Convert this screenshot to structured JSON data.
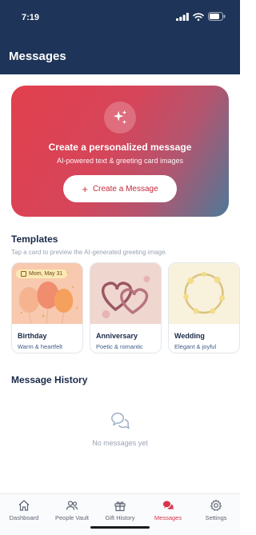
{
  "status_bar": {
    "time": "7:19"
  },
  "header": {
    "title": "Messages"
  },
  "hero": {
    "title": "Create a personalized message",
    "subtitle": "AI-powered text & greeting card images",
    "button_label": "Create a Message",
    "button_icon": "plus-icon",
    "badge_icon": "sparkles-icon"
  },
  "templates": {
    "title": "Templates",
    "hint": "Tap a card to preview the AI-generated greeting image.",
    "cards": [
      {
        "name": "Birthday",
        "subtitle": "Warm & heartfelt",
        "date_chip": "Mom, May 31"
      },
      {
        "name": "Anniversary",
        "subtitle": "Poetic & romantic"
      },
      {
        "name": "Wedding",
        "subtitle": "Elegant & joyful"
      }
    ]
  },
  "history": {
    "title": "Message History",
    "empty_text": "No messages yet",
    "empty_icon": "chat-bubbles-icon"
  },
  "tabs": [
    {
      "label": "Dashboard",
      "icon": "home-icon",
      "active": false
    },
    {
      "label": "People Vault",
      "icon": "people-icon",
      "active": false
    },
    {
      "label": "Gift History",
      "icon": "gift-icon",
      "active": false
    },
    {
      "label": "Messages",
      "icon": "chat-bubbles-icon",
      "active": true
    },
    {
      "label": "Settings",
      "icon": "gear-icon",
      "active": false
    }
  ],
  "colors": {
    "header": "#1e3458",
    "accent": "#d9344a",
    "hero_start": "#e2404d",
    "hero_end": "#4e7998"
  }
}
